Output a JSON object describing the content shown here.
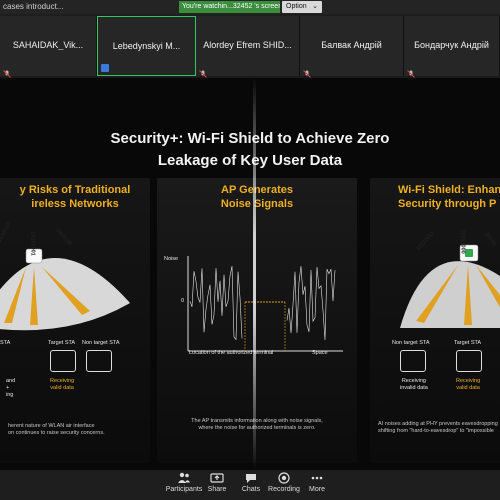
{
  "topbar": {
    "left_text": "cases introduct...",
    "sharing_banner": "You're watchin...32452 's screen.",
    "option_label": "Option"
  },
  "participants": [
    {
      "name": "SAHAIDAK_Vik..."
    },
    {
      "name": "Lebedynskyi M..."
    },
    {
      "name": "Alordey Efrem SHID..."
    },
    {
      "name": "Балвак Андрій"
    },
    {
      "name": "Бондарчук Андрій"
    }
  ],
  "slide": {
    "title_line1": "Security+: Wi-Fi Shield to Achieve Zero",
    "title_line2": "Leakage of Key User Data",
    "left": {
      "heading_line1": "y Risks of Traditional",
      "heading_line2": "ireless Networks",
      "ap_bits_left": "10100010",
      "ap_bits_mid": "10101001",
      "ap_bits_right": "1000100",
      "sta_left": "STA",
      "sta_target": "Target STA",
      "sta_nontarget": "Non target STA",
      "left_note_line1": "and",
      "left_note_line2": "+",
      "left_note_line3": "ing",
      "receiving_line1": "Receiving",
      "receiving_line2": "valid data",
      "caption_line1": "herent nature of WLAN air interface",
      "caption_line2": "on continues to raise security concerns."
    },
    "middle": {
      "heading_line1": "AP Generates",
      "heading_line2": "Noise Signals",
      "y_axis": "Noise",
      "zero": "0",
      "x_axis": "Space",
      "location_label": "Location of the authorized terminal",
      "caption_line1": "The AP transmits information along with noise signals,",
      "caption_line2": "where the noise for authorized terminals is zero."
    },
    "right": {
      "heading_line1": "Wi-Fi Shield: Enhan",
      "heading_line2": "Security through P",
      "bits_left": "10110011",
      "bits_mid": "10101000",
      "bits_right": "10100",
      "sta_nontarget": "Non target STA",
      "sta_target": "Target STA",
      "receiving_invalid_line1": "Receiving",
      "receiving_invalid_line2": "invalid data",
      "receiving_valid_line1": "Receiving",
      "receiving_valid_line2": "valid data",
      "caption_line1": "AI noises adding at PHY prevents eavesdropping",
      "caption_line2": "shifting from \"hard-to-eavesdrop\" to \"impossible"
    }
  },
  "toolbar": [
    {
      "label": "Participants",
      "icon": "participants-icon"
    },
    {
      "label": "Share",
      "icon": "share-icon"
    },
    {
      "label": "Chats",
      "icon": "chat-icon"
    },
    {
      "label": "Recording",
      "icon": "recording-icon"
    },
    {
      "label": "More",
      "icon": "more-icon"
    }
  ],
  "colors": {
    "accent_orange": "#f0b020",
    "banner_green": "#3a8d3c",
    "active_tile_border": "#2ec866"
  }
}
